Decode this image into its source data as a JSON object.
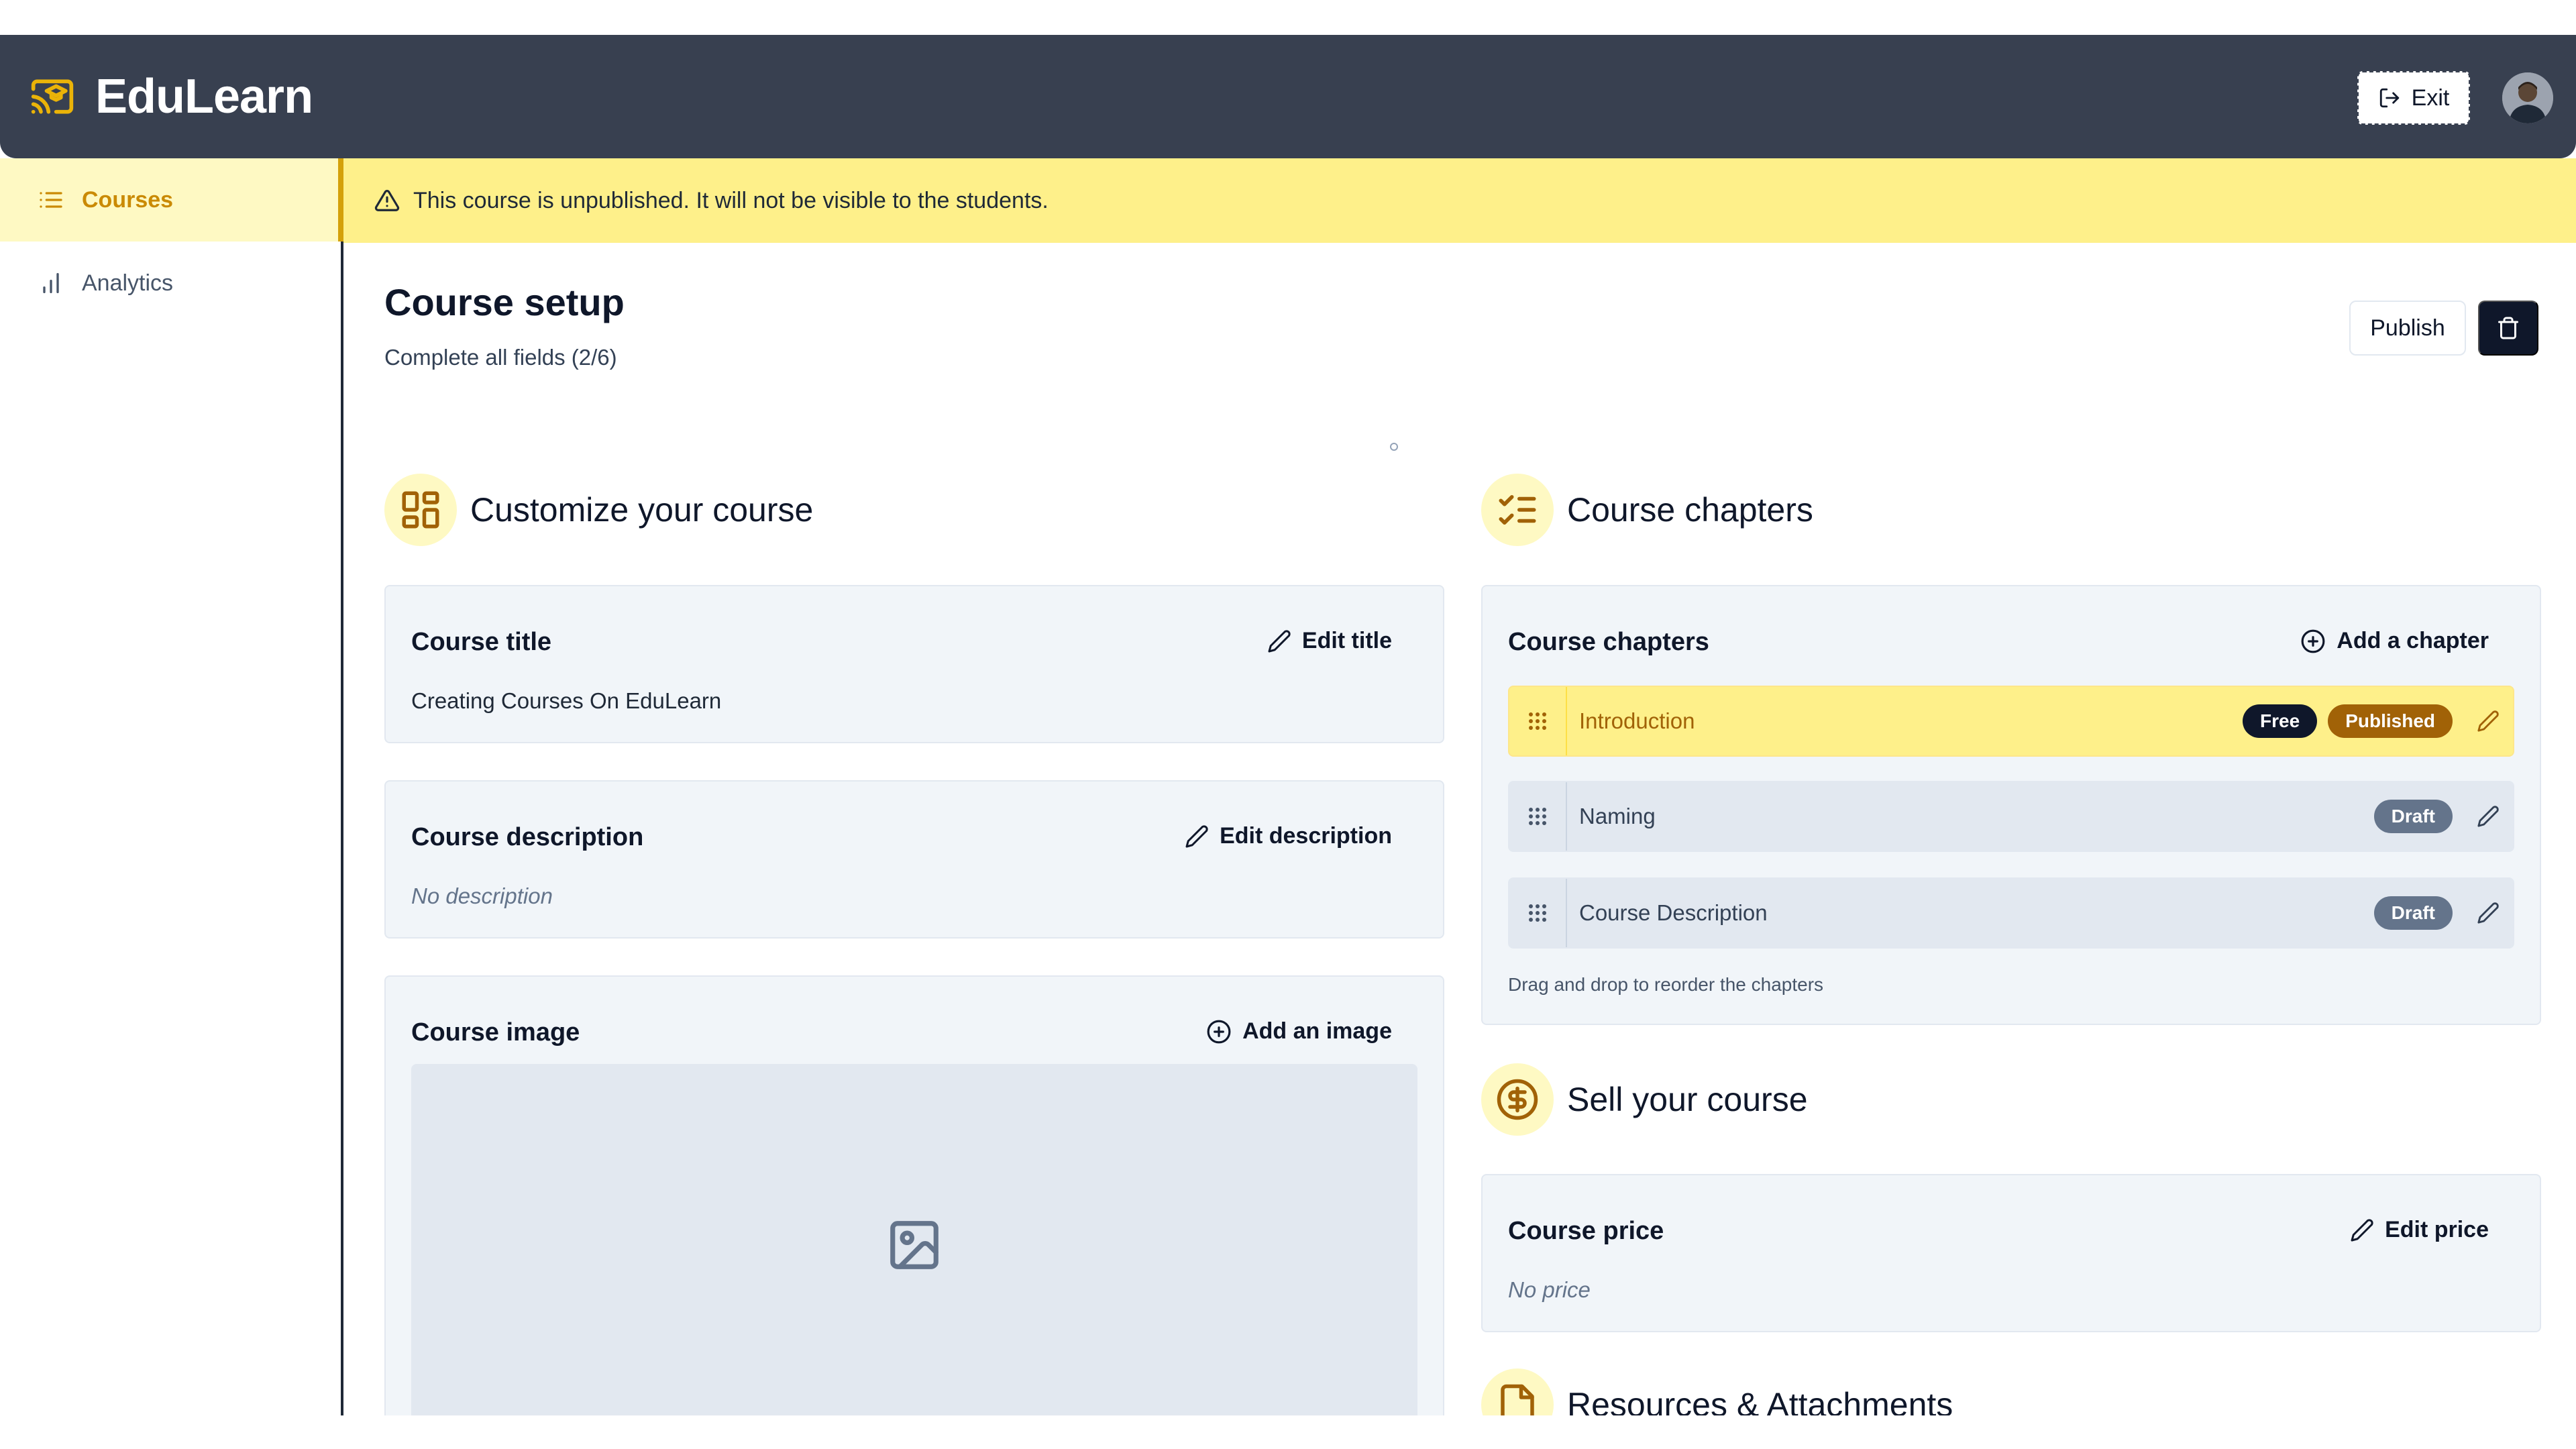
{
  "app": {
    "brand": "EduLearn",
    "exit_label": "Exit"
  },
  "sidebar": {
    "items": [
      {
        "label": "Courses",
        "active": true
      },
      {
        "label": "Analytics",
        "active": false
      }
    ]
  },
  "banner": {
    "text": "This course is unpublished. It will not be visible to the students."
  },
  "page": {
    "title": "Course setup",
    "subtitle": "Complete all fields (2/6)",
    "publish_label": "Publish"
  },
  "sections": {
    "customize": {
      "title": "Customize your course"
    },
    "chapters": {
      "title": "Course chapters"
    },
    "sell": {
      "title": "Sell your course"
    },
    "resources": {
      "title": "Resources & Attachments"
    }
  },
  "course_title": {
    "label": "Course title",
    "action": "Edit title",
    "value": "Creating Courses On EduLearn"
  },
  "course_description": {
    "label": "Course description",
    "action": "Edit description",
    "value": "No description"
  },
  "course_image": {
    "label": "Course image",
    "action": "Add an image"
  },
  "chapters_card": {
    "label": "Course chapters",
    "action": "Add a chapter",
    "hint": "Drag and drop to reorder the chapters",
    "items": [
      {
        "name": "Introduction",
        "badges": [
          "Free",
          "Published"
        ]
      },
      {
        "name": "Naming",
        "badges": [
          "Draft"
        ]
      },
      {
        "name": "Course Description",
        "badges": [
          "Draft"
        ]
      }
    ]
  },
  "course_price": {
    "label": "Course price",
    "action": "Edit price",
    "value": "No price"
  },
  "colors": {
    "topbar": "#384050",
    "accent": "#ca8a04",
    "banner": "#fef08a",
    "published": "#a16207"
  }
}
